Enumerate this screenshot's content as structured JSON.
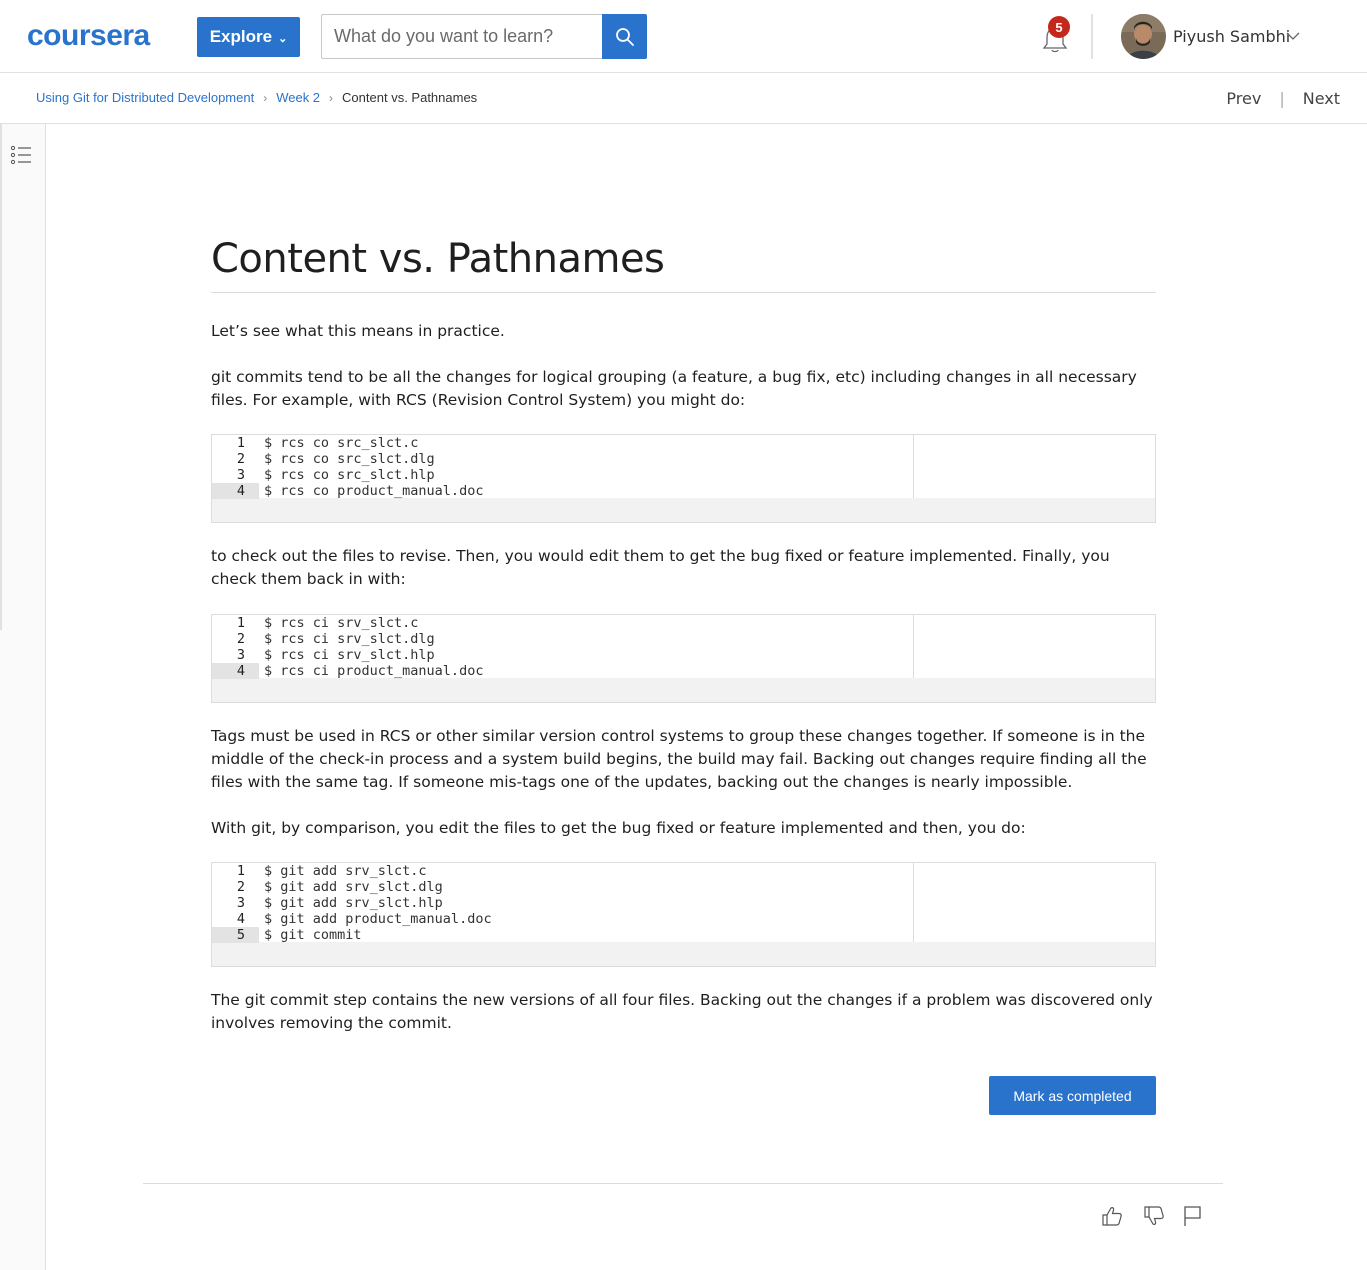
{
  "header": {
    "logo": "coursera",
    "explore_label": "Explore",
    "search_placeholder": "What do you want to learn?",
    "notification_count": "5",
    "user_name": "Piyush Sambhi"
  },
  "breadcrumb": {
    "items": [
      "Using Git for Distributed Development",
      "Week 2",
      "Content vs. Pathnames"
    ],
    "prev": "Prev",
    "separator": "|",
    "next": "Next"
  },
  "page": {
    "title": "Content vs. Pathnames",
    "p1": "Let’s see what this means in practice.",
    "p2": "git commits tend to be all the changes for logical grouping (a feature, a bug fix, etc) including changes in all necessary files. For example, with RCS (Revision Control System) you might do:",
    "code1": [
      "$ rcs co src_slct.c",
      "$ rcs co src_slct.dlg",
      "$ rcs co src_slct.hlp",
      "$ rcs co product_manual.doc"
    ],
    "p3": "to check out the files to revise. Then, you would edit them to get the bug fixed or feature implemented. Finally, you check them back in with:",
    "code2": [
      "$ rcs ci srv_slct.c",
      "$ rcs ci srv_slct.dlg",
      "$ rcs ci srv_slct.hlp",
      "$ rcs ci product_manual.doc"
    ],
    "p4": "Tags must be used in RCS or other similar version control systems to group these changes together. If someone is in the middle of the check-in process and a system build begins, the build may fail. Backing out changes require finding all the files with the same tag. If someone mis-tags one of the updates, backing out the changes is nearly impossible.",
    "p5": "With git, by comparison, you edit the files to get the bug fixed or feature implemented and then, you do:",
    "code3": [
      "$ git add srv_slct.c",
      "$ git add srv_slct.dlg",
      "$ git add srv_slct.hlp",
      "$ git add product_manual.doc",
      "$ git commit"
    ],
    "p6": "The git commit step contains the new versions of all four files. Backing out the changes if a problem was discovered only involves removing the commit.",
    "mark_completed": "Mark as completed"
  },
  "colors": {
    "brand": "#2a73cc",
    "badge": "#c4281c"
  },
  "icons": [
    "search-icon",
    "bell-icon",
    "chevron-down-icon",
    "toc-list-icon",
    "thumbs-up-icon",
    "thumbs-down-icon",
    "flag-icon"
  ]
}
